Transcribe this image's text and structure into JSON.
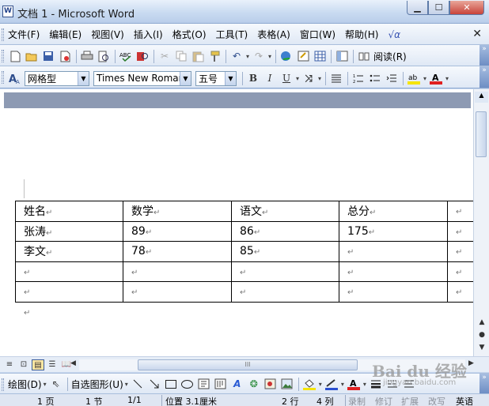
{
  "window": {
    "title": "文档 1 - Microsoft Word",
    "app_icon": "word-doc-icon",
    "controls": {
      "minimize": "minimize-icon",
      "maximize": "maximize-icon",
      "close": "close-icon"
    }
  },
  "menubar": {
    "items": [
      "文件(F)",
      "编辑(E)",
      "视图(V)",
      "插入(I)",
      "格式(O)",
      "工具(T)",
      "表格(A)",
      "窗口(W)",
      "帮助(H)"
    ],
    "formula_glyph": "√α"
  },
  "standard_toolbar": {
    "icons": [
      "new-doc-icon",
      "open-folder-icon",
      "save-icon",
      "permission-icon",
      "print-icon",
      "print-preview-icon",
      "spelling-icon",
      "research-icon",
      "cut-icon",
      "copy-icon",
      "paste-icon",
      "format-painter-icon",
      "undo-icon",
      "redo-icon",
      "hyperlink-icon",
      "tables-borders-icon",
      "insert-table-icon",
      "document-map-icon"
    ],
    "read_label": "阅读(R)"
  },
  "formatting_toolbar": {
    "style": "网格型",
    "font": "Times New Roman",
    "font_size": "五号",
    "bold": "B",
    "italic": "I",
    "underline": "U",
    "highlight_color": "#f5e400",
    "font_color": "#e02020"
  },
  "document": {
    "table": {
      "rows": [
        [
          "姓名↵",
          "数学↵",
          "语文↵",
          "总分↵",
          "↵"
        ],
        [
          "张涛↵",
          "89↵",
          "86↵",
          "175↵",
          "↵"
        ],
        [
          "李文↵",
          "78↵",
          "85↵",
          "↵",
          "↵"
        ],
        [
          "↵",
          "↵",
          "↵",
          "↵",
          "↵"
        ],
        [
          "↵",
          "↵",
          "↵",
          "↵",
          "↵"
        ]
      ]
    },
    "paragraph_mark": "↵"
  },
  "hscroll": {
    "center_grip": "III"
  },
  "drawing_toolbar": {
    "draw_label": "绘图(D)",
    "autoshapes_label": "自选图形(U)"
  },
  "statusbar": {
    "page": "1 页",
    "section": "1 节",
    "pages": "1/1",
    "position": "位置 3.1厘米",
    "line": "2 行",
    "column": "4 列",
    "rec": "录制",
    "trk": "修订",
    "ext": "扩展",
    "ovr": "改写",
    "lang": "英语"
  },
  "watermark": {
    "line1": "Bai du 经验",
    "line2": "jingyan.baidu.com"
  }
}
